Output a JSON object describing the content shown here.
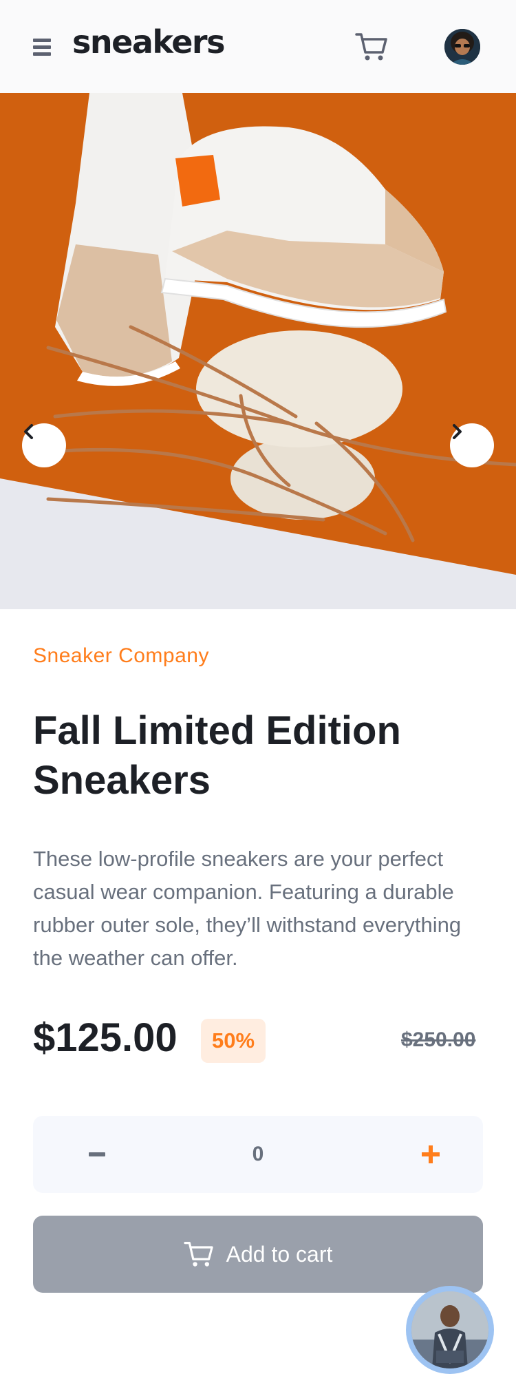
{
  "header": {
    "logo": "sneakers",
    "icons": [
      "menu-icon",
      "cart-icon",
      "avatar"
    ]
  },
  "gallery": {
    "prev_icon": "chevron-left-icon",
    "next_icon": "chevron-right-icon"
  },
  "product": {
    "company": "Sneaker Company",
    "title": "Fall Limited Edition Sneakers",
    "description": "These low-profile sneakers are your perfect casual wear companion. Featuring a durable rubber outer sole, they’ll withstand everything the weather can offer.",
    "price": "$125.00",
    "discount": "50%",
    "original_price": "$250.00"
  },
  "quantity": {
    "value": "0",
    "minus_icon": "minus-icon",
    "plus_icon": "plus-icon"
  },
  "actions": {
    "add_to_cart": "Add to cart"
  },
  "colors": {
    "accent": "#ff7d1b",
    "accent_pale": "#ffede0",
    "text_dark": "#1d2026",
    "text_muted": "#68707d",
    "button_disabled": "#9aa0ab",
    "qty_bg": "#f6f8fd"
  }
}
